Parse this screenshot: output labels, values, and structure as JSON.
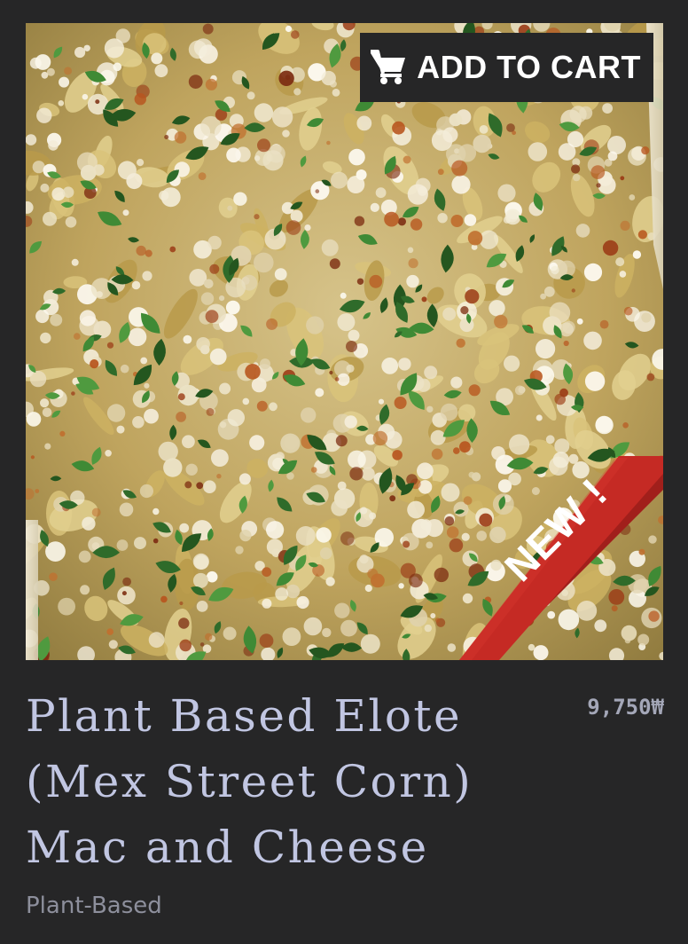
{
  "product": {
    "image_alt": "Plant Based Elote (Mex Street Corn) Mac and Cheese",
    "cart_button": {
      "label": "ADD TO CART",
      "icon": "shopping-cart-icon"
    },
    "badge": {
      "label": "NEW !",
      "color": "#c52a24"
    },
    "title": "Plant Based Elote (Mex Street Corn) Mac and Cheese",
    "price": "9,750₩",
    "category": "Plant-Based"
  },
  "colors": {
    "background": "#262627",
    "title": "#c1c6e2",
    "price": "#a4a7b8",
    "category": "#8d8f9c",
    "button_bg": "#262627"
  }
}
